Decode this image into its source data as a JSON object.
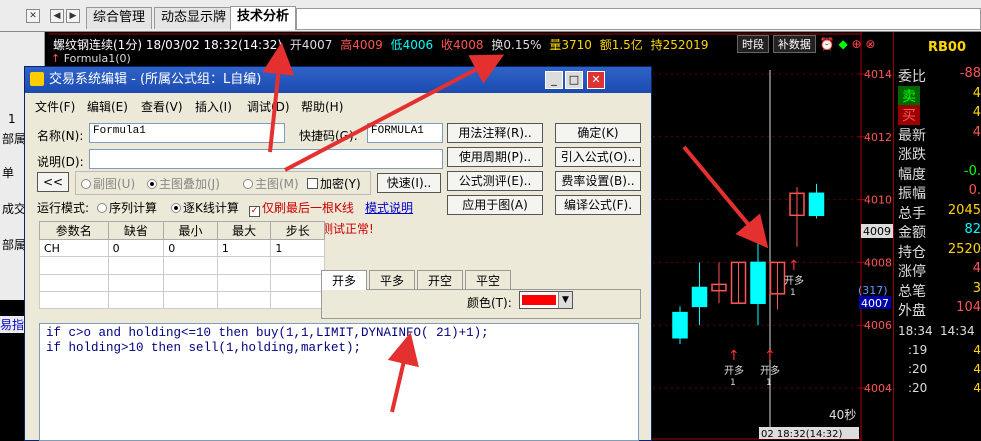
{
  "tabs": [
    {
      "label": "综合管理"
    },
    {
      "label": "动态显示牌"
    },
    {
      "label": "技术分析"
    }
  ],
  "left_panel": [
    "1",
    "部属",
    "单",
    "成交",
    "部属",
    "易指标"
  ],
  "infobar": {
    "symbol": "螺纹钢连续(1分) 18/03/02 18:32(14:32)",
    "open": "开4007",
    "high": "高4009",
    "low": "低4006",
    "close": "收4008",
    "change": "换0.15%",
    "volume": "量3710",
    "amount": "额1.5亿",
    "hold": "持252019",
    "btn_time": "时段",
    "btn_fill": "补数据",
    "formula_label": "Formula1(0)"
  },
  "chart": {
    "price_ticks": [
      "4014",
      "4012",
      "4010",
      "4008",
      "4006",
      "4004"
    ],
    "current_price_tag": "4009",
    "side_tags": [
      "(317)",
      "4007"
    ],
    "signals": [
      {
        "label": "开多",
        "sub": "1"
      },
      {
        "label": "开多",
        "sub": "1"
      },
      {
        "label": "开多",
        "sub": "1"
      }
    ],
    "interval_label": "40秒",
    "bottom_label": "02 18:32(14:32)",
    "candles": [
      {
        "o": 4005.6,
        "c": 4006.4,
        "h": 4006.6,
        "l": 4005.4,
        "color": "#00ffff"
      },
      {
        "o": 4006.6,
        "c": 4007.2,
        "h": 4008.0,
        "l": 4006.0,
        "color": "#00ffff"
      },
      {
        "o": 4007.1,
        "c": 4007.3,
        "h": 4008.0,
        "l": 4006.7,
        "color": "#ff5555"
      },
      {
        "o": 4006.7,
        "c": 4008.0,
        "h": 4008.0,
        "l": 4006.7,
        "color": "#ff5555"
      },
      {
        "o": 4008.0,
        "c": 4006.7,
        "h": 4009.5,
        "l": 4006.0,
        "color": "#00ffff"
      },
      {
        "o": 4007.0,
        "c": 4008.0,
        "h": 4008.0,
        "l": 4006.5,
        "color": "#ff5555"
      },
      {
        "o": 4009.5,
        "c": 4010.2,
        "h": 4010.4,
        "l": 4008.5,
        "color": "#ff5555"
      },
      {
        "o": 4010.2,
        "c": 4009.5,
        "h": 4010.5,
        "l": 4009.4,
        "color": "#00ffff"
      }
    ]
  },
  "quote": {
    "header": "RB00",
    "rows": [
      {
        "label": "委比",
        "value": "-88",
        "color": "#ff5555"
      },
      {
        "label": "卖",
        "value": "4",
        "color": "#ffd700"
      },
      {
        "label": "买",
        "value": "4",
        "color": "#ffd700"
      },
      {
        "label": "最新",
        "value": "4",
        "color": "#ff5555"
      },
      {
        "label": "涨跌",
        "value": "",
        "color": "#ff5555"
      },
      {
        "label": "幅度",
        "value": "-0.",
        "color": "#00ff00"
      },
      {
        "label": "振幅",
        "value": "0.",
        "color": "#ff5555"
      },
      {
        "label": "总手",
        "value": "2045",
        "color": "#ffd700"
      },
      {
        "label": "金额",
        "value": "82",
        "color": "#00ffff"
      },
      {
        "label": "持仓",
        "value": "2520",
        "color": "#ffd700"
      },
      {
        "label": "涨停",
        "value": "4",
        "color": "#ff5555"
      },
      {
        "label": "总笔",
        "value": "3",
        "color": "#ffd700"
      },
      {
        "label": "外盘",
        "value": "104",
        "color": "#ff5555"
      }
    ],
    "times": [
      "18:34",
      "14:34",
      ":19",
      ":20",
      ":20"
    ],
    "time_values": [
      "4",
      "4",
      "4"
    ]
  },
  "dialog": {
    "title": "交易系统编辑 - (所属公式组：L自编)",
    "menu": [
      "文件(F)",
      "编辑(E)",
      "查看(V)",
      "插入(I)",
      "调试(D)",
      "帮助(H)"
    ],
    "name_label": "名称(N):",
    "name_value": "Formula1",
    "hotkey_label": "快捷码(G):",
    "hotkey_value": "FORMULA1",
    "desc_label": "说明(D):",
    "desc_value": "",
    "buttons": {
      "usage_note": "用法注释(R)..",
      "confirm": "确定(K)",
      "period": "使用周期(P)..",
      "import": "引入公式(O)..",
      "test": "公式测评(E)..",
      "fee": "费率设置(B)..",
      "apply": "应用于图(A)",
      "encode": "编译公式(F).",
      "collapse": "<<",
      "fast": "快速(I).."
    },
    "mode_options": {
      "sub_chart": "副图(U)",
      "main_overlay": "主图叠加(J)",
      "main_chart": "主图(M)",
      "encrypt": "加密(Y)"
    },
    "run_mode_label": "运行模式:",
    "run_modes": {
      "sequence": "序列计算",
      "tick": "逐K线计算",
      "last_bar": "仅刷最后一根K线"
    },
    "model_link": "模式说明",
    "test_ok": "测试正常!",
    "param_headers": [
      "参数名",
      "缺省",
      "最小",
      "最大",
      "步长"
    ],
    "param_rows": [
      [
        "CH",
        "0",
        "0",
        "1",
        "1"
      ]
    ],
    "position_tabs": [
      "开多",
      "平多",
      "开空",
      "平空"
    ],
    "color_label": "颜色(T):",
    "code_lines": [
      "if c>o and holding<=10 then buy(1,1,LIMIT,DYNAINFO( 21)+1);",
      "if holding>10 then sell(1,holding,market);"
    ]
  }
}
